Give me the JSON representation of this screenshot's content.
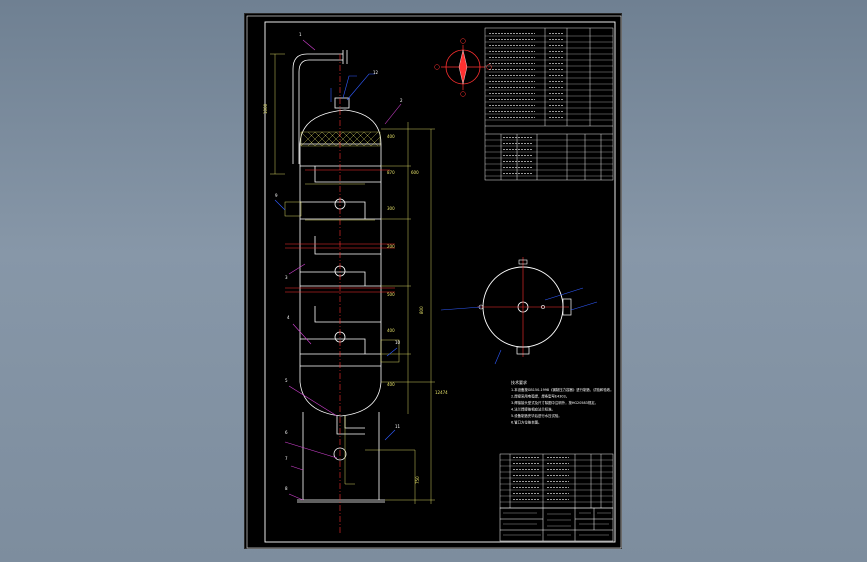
{
  "colors": {
    "background": "#7a8a9c",
    "sheet": "#000000",
    "frame": "#ffffff",
    "vessel": "#ffffff",
    "dimension": "#e8e46a",
    "leader_blue": "#2f5bff",
    "centerline_red": "#ff3030",
    "leader_magenta": "#d040d0"
  },
  "labels": {
    "tech_notes_title": "技术要求",
    "tech_notes_lines": [
      "1.本设备按GB150-1998《钢制压力容器》进行制造、试验和验收。",
      "2.焊接采用电弧焊，焊条型号E4303。",
      "3.焊接接头型式及尺寸除图中注明外，按HG20583规定。",
      "4.法兰焊接按相应法兰标准。",
      "5.设备制造完毕后进行水压试验。",
      "6.管口方位按本图。"
    ],
    "dims": [
      "1000",
      "400",
      "870",
      "300",
      "200",
      "500",
      "400",
      "600",
      "800",
      "750",
      "12474",
      "400"
    ],
    "part_numbers": [
      "1",
      "2",
      "3",
      "4",
      "5",
      "6",
      "7",
      "8",
      "9",
      "10",
      "11",
      "12"
    ]
  },
  "icons": {
    "orientation": "compass-rose-icon",
    "plan_view": "nozzle-orientation-plan-icon"
  }
}
